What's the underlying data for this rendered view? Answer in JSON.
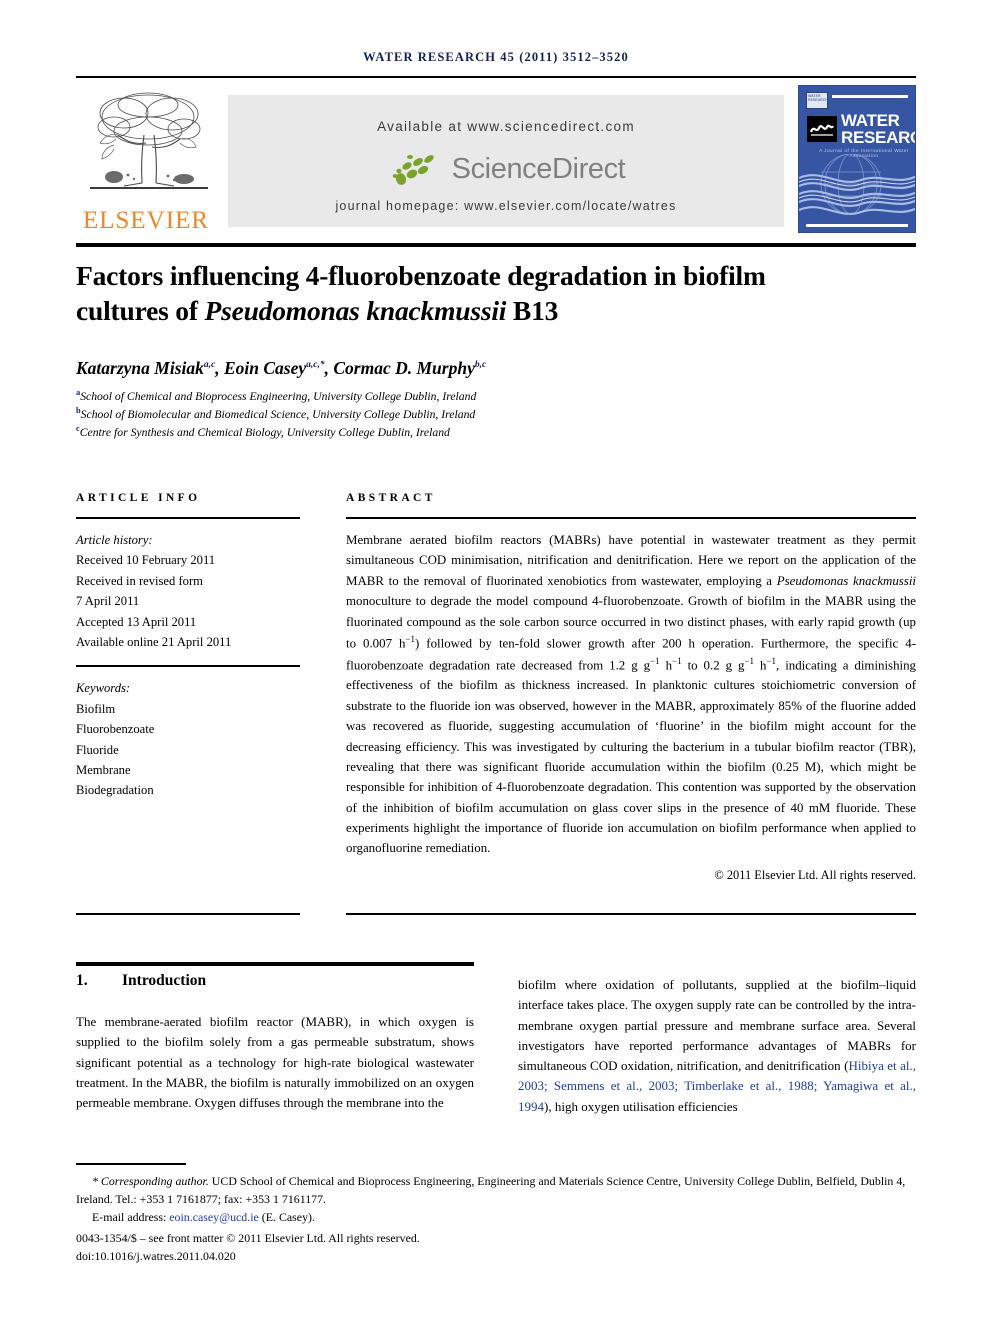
{
  "running_head": "WATER RESEARCH 45 (2011) 3512–3520",
  "masthead": {
    "publisher_name": "ELSEVIER",
    "available_at": "Available at www.sciencedirect.com",
    "sciencedirect_wordmark": "ScienceDirect",
    "journal_homepage": "journal homepage: www.elsevier.com/locate/watres",
    "cover": {
      "title_line1": "WATER",
      "title_line2": "RESEARCH",
      "society_line": "A Journal of the International Water Association",
      "iwa_mark": "IWA",
      "corner_text": "WATER RESEARCH"
    }
  },
  "article": {
    "title_line1": "Factors influencing 4-fluorobenzoate degradation in biofilm",
    "title_line2_prefix": "cultures of ",
    "title_line2_italic": "Pseudomonas knackmussii",
    "title_line2_suffix": " B13",
    "authors": [
      {
        "name": "Katarzyna Misiak",
        "sup": "a,c",
        "sep": ", "
      },
      {
        "name": "Eoin Casey",
        "sup": "a,c,*",
        "sep": ", "
      },
      {
        "name": "Cormac D. Murphy",
        "sup": "b,c",
        "sep": ""
      }
    ],
    "affiliations": [
      {
        "marker": "a",
        "text": "School of Chemical and Bioprocess Engineering, University College Dublin, Ireland"
      },
      {
        "marker": "b",
        "text": "School of Biomolecular and Biomedical Science, University College Dublin, Ireland"
      },
      {
        "marker": "c",
        "text": "Centre for Synthesis and Chemical Biology, University College Dublin, Ireland"
      }
    ]
  },
  "article_info": {
    "heading": "ARTICLE INFO",
    "history_label": "Article history:",
    "history": [
      "Received 10 February 2011",
      "Received in revised form",
      "7 April 2011",
      "Accepted 13 April 2011",
      "Available online 21 April 2011"
    ],
    "keywords_label": "Keywords:",
    "keywords": [
      "Biofilm",
      "Fluorobenzoate",
      "Fluoride",
      "Membrane",
      "Biodegradation"
    ]
  },
  "abstract": {
    "heading": "ABSTRACT",
    "part1": "Membrane aerated biofilm reactors (MABRs) have potential in wastewater treatment as they permit simultaneous COD minimisation, nitrification and denitrification. Here we report on the application of the MABR to the removal of fluorinated xenobiotics from wastewater, employing a ",
    "organism1": "Pseudomonas knackmussii",
    "part2": " monoculture to degrade the model compound 4-fluorobenzoate. Growth of biofilm in the MABR using the fluorinated compound as the sole carbon source occurred in two distinct phases, with early rapid growth (up to 0.007 h",
    "sup1": "−1",
    "part3": ") followed by ten-fold slower growth after 200 h operation. Furthermore, the specific 4-fluorobenzoate degradation rate decreased from 1.2 g g",
    "sup2": "−1",
    "part4": " h",
    "sup3": "−1",
    "part5": " to 0.2 g g",
    "sup4": "−1",
    "part6": " h",
    "sup5": "−1",
    "part7": ", indicating a diminishing effectiveness of the biofilm as thickness increased. In planktonic cultures stoichiometric conversion of substrate to the fluoride ion was observed, however in the MABR, approximately 85% of the fluorine added was recovered as fluoride, suggesting accumulation of ‘fluorine’ in the biofilm might account for the decreasing efficiency. This was investigated by culturing the bacterium in a tubular biofilm reactor (TBR), revealing that there was significant fluoride accumulation within the biofilm (0.25 M), which might be responsible for inhibition of 4-fluorobenzoate degradation. This contention was supported by the observation of the inhibition of biofilm accumulation on glass cover slips in the presence of 40 mM fluoride. These experiments highlight the importance of fluoride ion accumulation on biofilm performance when applied to organofluorine remediation.",
    "copyright": "© 2011 Elsevier Ltd. All rights reserved."
  },
  "introduction": {
    "number": "1.",
    "heading": "Introduction",
    "left_column": "The membrane-aerated biofilm reactor (MABR), in which oxygen is supplied to the biofilm solely from a gas permeable substratum, shows significant potential as a technology for high-rate biological wastewater treatment. In the MABR, the biofilm is naturally immobilized on an oxygen permeable membrane. Oxygen diffuses through the membrane into the",
    "right_part1": "biofilm where oxidation of pollutants, supplied at the biofilm–liquid interface takes place. The oxygen supply rate can be controlled by the intra-membrane oxygen partial pressure and membrane surface area. Several investigators have reported performance advantages of MABRs for simultaneous COD oxidation, nitrification, and denitrification (",
    "citations": "Hibiya et al., 2003; Semmens et al., 2003; Timberlake et al., 1988; Yamagiwa et al., 1994",
    "right_part2": "), high oxygen utilisation efficiencies"
  },
  "footnote": {
    "corresponding_label": "* Corresponding author.",
    "corresponding_text": " UCD School of Chemical and Bioprocess Engineering, Engineering and Materials Science Centre, University College Dublin, Belfield, Dublin 4, Ireland. Tel.: +353 1 7161877; fax: +353 1 7161177.",
    "email_label": "E-mail address: ",
    "email": "eoin.casey@ucd.ie",
    "email_suffix": " (E. Casey).",
    "issn_line": "0043-1354/$ – see front matter © 2011 Elsevier Ltd. All rights reserved.",
    "doi_line": "doi:10.1016/j.watres.2011.04.020"
  }
}
